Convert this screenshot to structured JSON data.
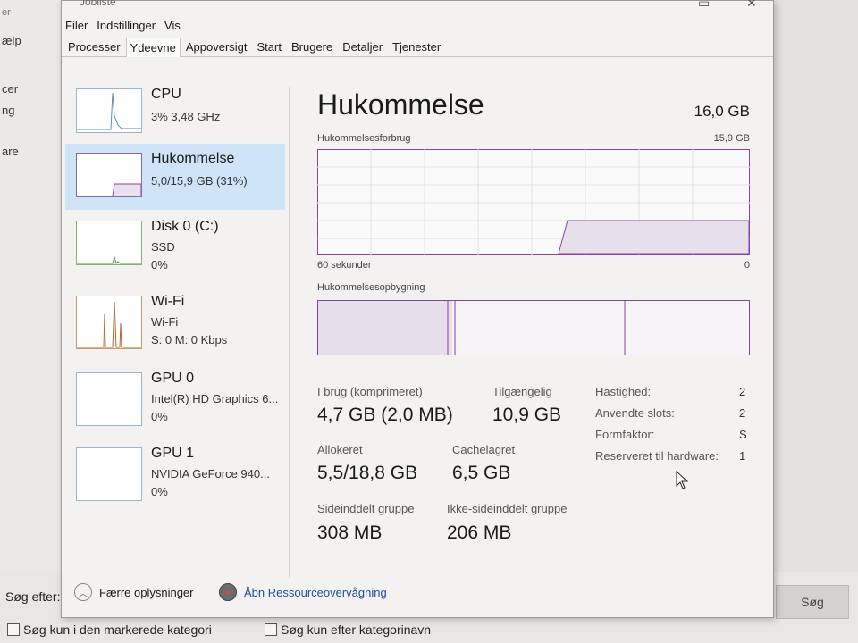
{
  "window": {
    "title": "Jobliste",
    "menu": [
      "Filer",
      "Indstillinger",
      "Vis"
    ],
    "tabs": [
      "Processer",
      "Ydeevne",
      "Appoversigt",
      "Start",
      "Brugere",
      "Detaljer",
      "Tjenester"
    ],
    "active_tab": "Ydeevne"
  },
  "background_app": {
    "left_texts": [
      "er",
      "ælp",
      "cer",
      "ng",
      "are"
    ],
    "search_label": "Søg efter:",
    "search_button": "Søg",
    "checkbox_1": "Søg kun i den markerede kategori",
    "checkbox_2": "Søg kun efter kategorinavn"
  },
  "sidebar": [
    {
      "name": "CPU",
      "line1": "3%  3,48 GHz",
      "line2": ""
    },
    {
      "name": "Hukommelse",
      "line1": "5,0/15,9 GB (31%)",
      "line2": ""
    },
    {
      "name": "Disk 0 (C:)",
      "line1": "SSD",
      "line2": "0%"
    },
    {
      "name": "Wi-Fi",
      "line1": "Wi-Fi",
      "line2": "S: 0 M: 0 Kbps"
    },
    {
      "name": "GPU 0",
      "line1": "Intel(R) HD Graphics 6...",
      "line2": "0%"
    },
    {
      "name": "GPU 1",
      "line1": "NVIDIA GeForce 940...",
      "line2": "0%"
    }
  ],
  "main": {
    "title": "Hukommelse",
    "total": "16,0 GB",
    "usage_label": "Hukommelsesforbrug",
    "usage_max": "15,9 GB",
    "time_left": "60 sekunder",
    "time_right": "0",
    "composition_label": "Hukommelsesopbygning",
    "stats": {
      "in_use_label": "I brug (komprimeret)",
      "in_use_value": "4,7 GB (2,0 MB)",
      "available_label": "Tilgængelig",
      "available_value": "10,9 GB",
      "committed_label": "Allokeret",
      "committed_value": "5,5/18,8 GB",
      "cached_label": "Cachelagret",
      "cached_value": "6,5 GB",
      "paged_label": "Sideinddelt gruppe",
      "paged_value": "308 MB",
      "nonpaged_label": "Ikke-sideinddelt gruppe",
      "nonpaged_value": "206 MB"
    },
    "specs": [
      {
        "label": "Hastighed:",
        "value": "2"
      },
      {
        "label": "Anvendte slots:",
        "value": "2"
      },
      {
        "label": "Formfaktor:",
        "value": "S"
      },
      {
        "label": "Reserveret til hardware:",
        "value": "1"
      }
    ]
  },
  "footer": {
    "fewer_details": "Færre oplysninger",
    "resource_monitor": "Åbn Ressourceovervågning"
  },
  "colors": {
    "memory_accent": "#8b3fa8",
    "selected_bg": "#cfe4f6",
    "link": "#1f4f9f"
  }
}
